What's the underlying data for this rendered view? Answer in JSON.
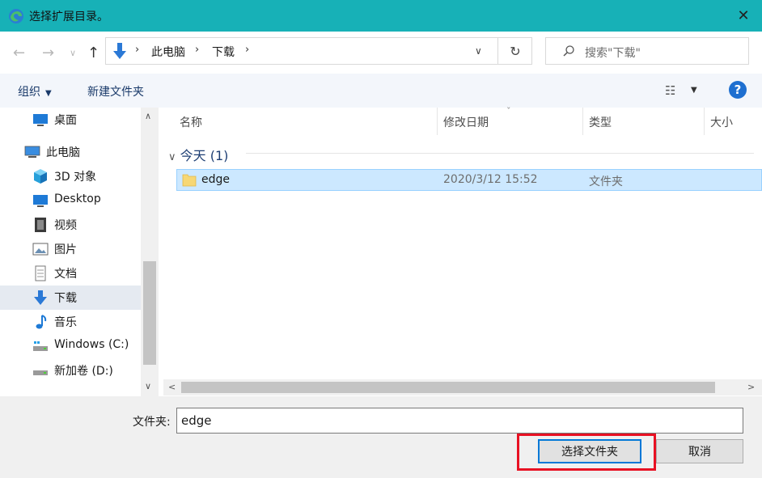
{
  "window": {
    "title": "选择扩展目录。",
    "close_glyph": "✕"
  },
  "nav": {
    "back_glyph": "←",
    "forward_glyph": "→",
    "recent_glyph": "∨",
    "up_glyph": "↑",
    "breadcrumbs": [
      "此电脑",
      "下载"
    ],
    "sep_glyph": "›",
    "dropdown_glyph": "∨",
    "refresh_glyph": "↻",
    "search_placeholder": "搜索\"下载\""
  },
  "toolbar": {
    "organize_label": "组织",
    "organize_caret": "▼",
    "new_folder_label": "新建文件夹",
    "view_glyph": "☷",
    "view_caret": "▼",
    "help_glyph": "?"
  },
  "sidebar": {
    "items": [
      {
        "label": "桌面",
        "icon": "desktop-icon"
      },
      {
        "label": "此电脑",
        "icon": "computer-icon"
      },
      {
        "label": "3D 对象",
        "icon": "cube-icon"
      },
      {
        "label": "Desktop",
        "icon": "desktop-icon"
      },
      {
        "label": "视频",
        "icon": "video-icon"
      },
      {
        "label": "图片",
        "icon": "picture-icon"
      },
      {
        "label": "文档",
        "icon": "document-icon"
      },
      {
        "label": "下载",
        "icon": "download-icon",
        "selected": true
      },
      {
        "label": "音乐",
        "icon": "music-icon"
      },
      {
        "label": "Windows (C:)",
        "icon": "drive-icon"
      },
      {
        "label": "新加卷 (D:)",
        "icon": "drive-icon"
      }
    ],
    "scroll_up_glyph": "∧",
    "scroll_down_glyph": "∨"
  },
  "filelist": {
    "columns": [
      "名称",
      "修改日期",
      "类型",
      "大小"
    ],
    "sort_glyph": "ˇ",
    "group_label": "今天 (1)",
    "group_caret": "∨",
    "rows": [
      {
        "name": "edge",
        "date": "2020/3/12 15:52",
        "type": "文件夹"
      }
    ],
    "scroll_left_glyph": "<",
    "scroll_right_glyph": ">"
  },
  "footer": {
    "folder_label": "文件夹:",
    "folder_value": "edge",
    "select_button": "选择文件夹",
    "cancel_button": "取消"
  },
  "colors": {
    "titlebar": "#17b1b7",
    "accent": "#0078d7",
    "selection": "#cce8ff",
    "highlight_box": "#e81123"
  }
}
